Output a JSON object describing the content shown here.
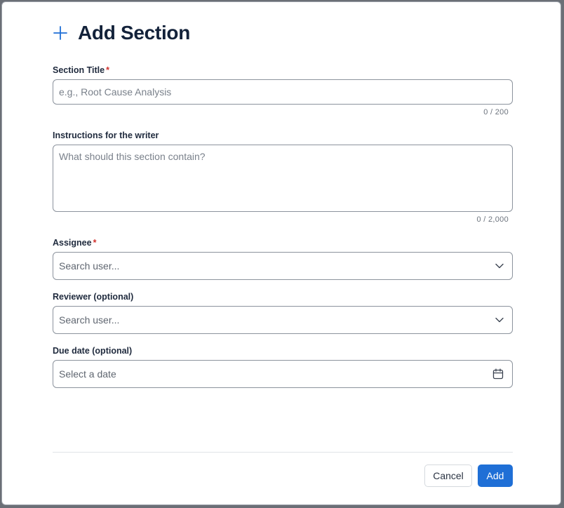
{
  "dialog": {
    "title": "Add Section",
    "fields": {
      "section_title": {
        "label": "Section Title",
        "required_marker": "*",
        "placeholder": "e.g., Root Cause Analysis",
        "value": "",
        "counter": "0 / 200"
      },
      "instructions": {
        "label": "Instructions for the writer",
        "placeholder": "What should this section contain?",
        "value": "",
        "counter": "0 / 2,000"
      },
      "assignee": {
        "label": "Assignee",
        "required_marker": "*",
        "placeholder": "Search user..."
      },
      "reviewer": {
        "label": "Reviewer (optional)",
        "placeholder": "Search user..."
      },
      "due_date": {
        "label": "Due date (optional)",
        "placeholder": "Select a date"
      }
    },
    "buttons": {
      "cancel": "Cancel",
      "add": "Add"
    }
  },
  "icons": {
    "header": "plus-icon",
    "select": "chevron-down-icon",
    "date": "calendar-icon"
  },
  "colors": {
    "accent": "#1f6fd6",
    "title": "#13223a",
    "required": "#d0312d"
  }
}
